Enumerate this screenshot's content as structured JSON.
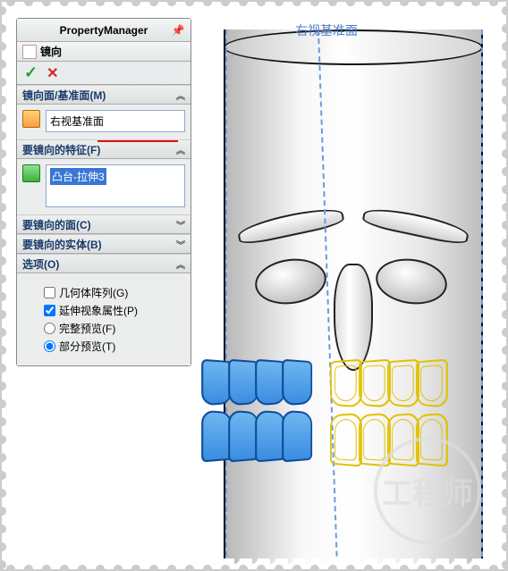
{
  "pm": {
    "title": "PropertyManager",
    "feature_name": "镜向"
  },
  "sections": {
    "plane": {
      "head": "镜向面/基准面(M)",
      "value": "右视基准面"
    },
    "features": {
      "head": "要镜向的特征(F)",
      "selected": "凸台-拉伸3"
    },
    "faces": {
      "head": "要镜向的面(C)"
    },
    "bodies": {
      "head": "要镜向的实体(B)"
    },
    "options": {
      "head": "选项(O)",
      "geom_pattern": "几何体阵列(G)",
      "extend_visual": "延伸视象属性(P)",
      "full_preview": "完整预览(F)",
      "partial_preview": "部分预览(T)"
    }
  },
  "viewport": {
    "plane_label": "右视基准面"
  },
  "watermark": "工程师",
  "icons": {
    "pin": "📌",
    "check": "✓",
    "cross": "✕",
    "chev_up": "︽",
    "chev_dn": "︾"
  }
}
